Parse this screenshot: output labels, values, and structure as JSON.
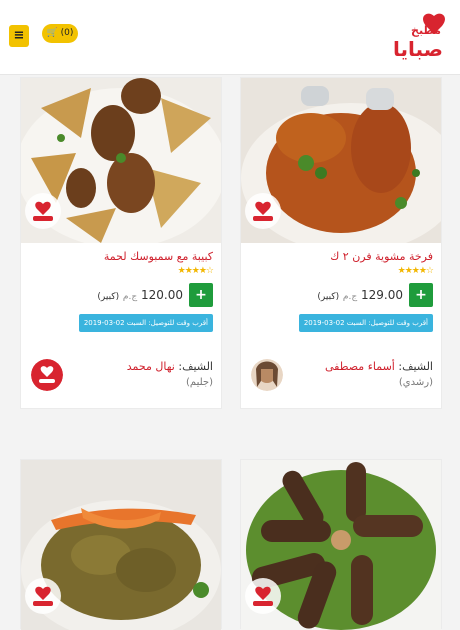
{
  "header": {
    "menu_icon_glyph": "≡",
    "cart_label": "🛒 (0)",
    "logo": {
      "line1": "مطبخ",
      "line2": "صبايا"
    }
  },
  "products": [
    {
      "title": "فرخة مشوية فرن ٢ ك",
      "rating": "★★★★☆",
      "add_glyph": "+",
      "price_value": "129.00",
      "price_unit": "ج.م",
      "price_size": "(كبير)",
      "delivery": "أقرب وقت للتوصيل: السبت 02-03-2019",
      "chef_label": "الشيف:",
      "chef_name": "أسماء مصطفى",
      "chef_region": "(رشدي)"
    },
    {
      "title": "كبيبة مع سمبوسك لحمة",
      "rating": "★★★★☆",
      "add_glyph": "+",
      "price_value": "120.00",
      "price_unit": "ج.م",
      "price_size": "(كبير)",
      "delivery": "أقرب وقت للتوصيل: السبت 02-03-2019",
      "chef_label": "الشيف:",
      "chef_name": "نهال محمد",
      "chef_region": "(جليم)"
    }
  ],
  "colors": {
    "accent_yellow": "#f2c200",
    "brand_red": "#cf1f2b",
    "add_green": "#1f9c3c",
    "delivery_blue": "#3ab4de"
  }
}
